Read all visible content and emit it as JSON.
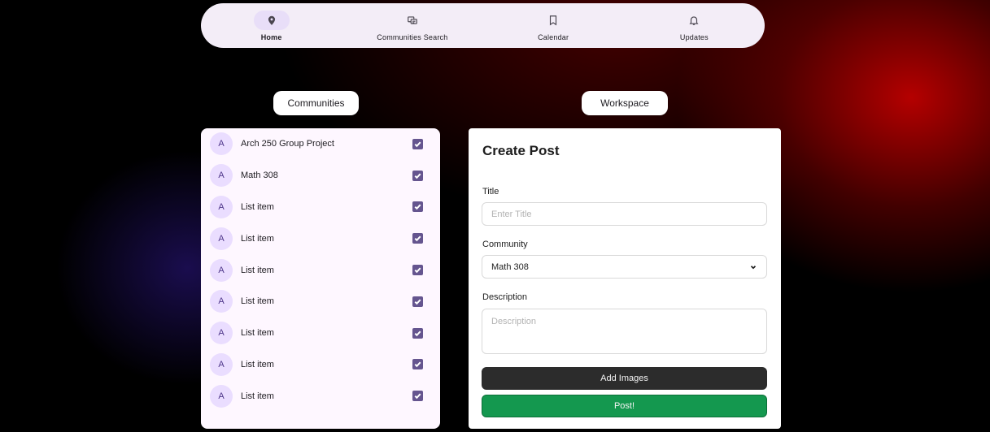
{
  "nav": {
    "items": [
      {
        "label": "Home",
        "icon": "location-pin-icon",
        "active": true
      },
      {
        "label": "Communities Search",
        "icon": "communities-icon",
        "active": false
      },
      {
        "label": "Calendar",
        "icon": "bookmark-icon",
        "active": false
      },
      {
        "label": "Updates",
        "icon": "bell-icon",
        "active": false
      }
    ]
  },
  "sections": {
    "communities_label": "Communities",
    "workspace_label": "Workspace"
  },
  "communities": {
    "items": [
      {
        "avatar": "A",
        "label": "Arch 250 Group Project",
        "checked": true
      },
      {
        "avatar": "A",
        "label": "Math 308",
        "checked": true
      },
      {
        "avatar": "A",
        "label": "List item",
        "checked": true
      },
      {
        "avatar": "A",
        "label": "List item",
        "checked": true
      },
      {
        "avatar": "A",
        "label": "List item",
        "checked": true
      },
      {
        "avatar": "A",
        "label": "List item",
        "checked": true
      },
      {
        "avatar": "A",
        "label": "List item",
        "checked": true
      },
      {
        "avatar": "A",
        "label": "List item",
        "checked": true
      },
      {
        "avatar": "A",
        "label": "List item",
        "checked": true
      }
    ]
  },
  "post_form": {
    "heading": "Create Post",
    "title_label": "Title",
    "title_placeholder": "Enter Title",
    "community_label": "Community",
    "community_value": "Math 308",
    "description_label": "Description",
    "description_placeholder": "Description",
    "add_images_label": "Add Images",
    "post_label": "Post!"
  },
  "colors": {
    "accent": "#65558f",
    "post_button": "#14984f",
    "dark_button": "#2c2c2c"
  }
}
